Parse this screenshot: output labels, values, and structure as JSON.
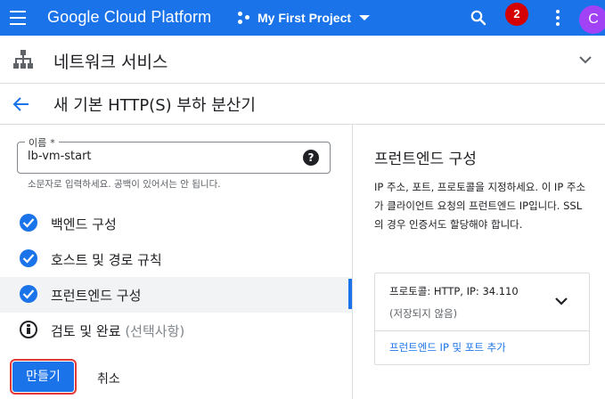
{
  "topbar": {
    "brand": "Google Cloud Platform",
    "project": "My First Project",
    "notifications_count": "2",
    "avatar_letter": "C",
    "colors": {
      "bar": "#1a73e8",
      "badge": "#d50000",
      "avatar": "#a142f4"
    }
  },
  "section": {
    "title": "네트워크 서비스",
    "icon": "network-services-icon"
  },
  "page": {
    "title": "새 기본 HTTP(S) 부하 분산기"
  },
  "form": {
    "name_label": "이름",
    "name_required_mark": "*",
    "name_value": "lb-vm-start",
    "name_hint": "소문자로 입력하세요. 공백이 있어서는 안 됩니다.",
    "help_glyph": "?"
  },
  "steps": [
    {
      "label": "백엔드 구성",
      "state": "done"
    },
    {
      "label": "호스트 및 경로 규칙",
      "state": "done"
    },
    {
      "label": "프런트엔드 구성",
      "state": "done",
      "active": true
    },
    {
      "label": "검토 및 완료",
      "optional": "(선택사항)",
      "state": "info"
    }
  ],
  "actions": {
    "create": "만들기",
    "cancel": "취소"
  },
  "panel": {
    "title": "프런트엔드 구성",
    "description": "IP 주소, 포트, 프로토콜을 지정하세요. 이 IP 주소가 클라이언트 요청의 프런트엔드 IP입니다. SSL의 경우 인증서도 할당해야 합니다.",
    "card": {
      "protocol": "프로토콜: HTTP, IP: 34.110",
      "status": "(저장되지 않음)",
      "add_link": "프런트엔드 IP 및 포트 추가"
    }
  }
}
